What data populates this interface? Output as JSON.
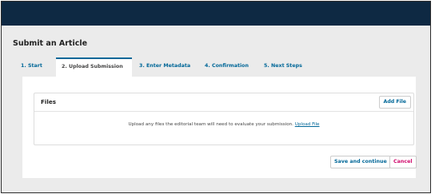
{
  "colors": {
    "topbar": "#0e2943",
    "accent": "#006798",
    "danger": "#d00a6c",
    "background": "#ebebeb"
  },
  "page": {
    "title": "Submit an Article"
  },
  "tabs": [
    {
      "label": "1. Start"
    },
    {
      "label": "2. Upload Submission"
    },
    {
      "label": "3. Enter Metadata"
    },
    {
      "label": "4. Confirmation"
    },
    {
      "label": "5. Next Steps"
    }
  ],
  "active_tab": "2. Upload Submission",
  "files": {
    "title": "Files",
    "add_button": "Add File",
    "empty_message": "Upload any files the editorial team will need to evaluate your submission.",
    "upload_link": "Upload File"
  },
  "actions": {
    "save": "Save and continue",
    "cancel": "Cancel"
  }
}
